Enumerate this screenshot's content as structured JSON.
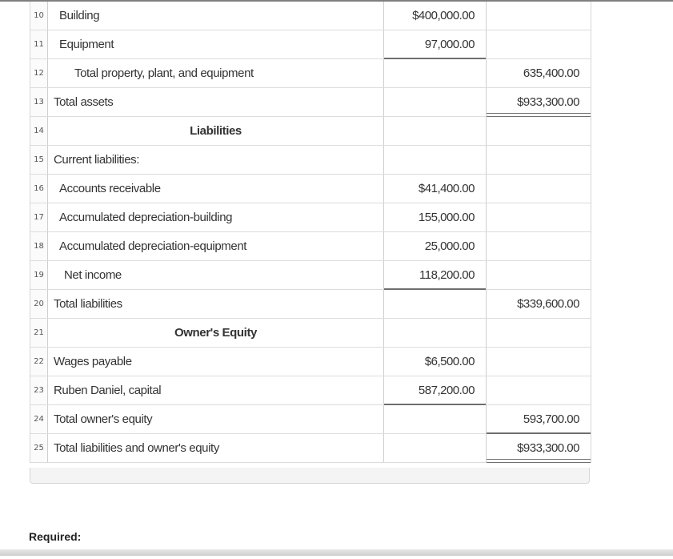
{
  "rows": [
    {
      "n": "10",
      "label": "Building",
      "c1": "$400,000.00",
      "c2": ""
    },
    {
      "n": "11",
      "label": "Equipment",
      "c1": "97,000.00",
      "c2": ""
    },
    {
      "n": "12",
      "label": "Total property, plant, and equipment",
      "c1": "",
      "c2": "635,400.00"
    },
    {
      "n": "13",
      "label": "Total assets",
      "c1": "",
      "c2": "$933,300.00"
    },
    {
      "n": "14",
      "label": "Liabilities",
      "c1": "",
      "c2": ""
    },
    {
      "n": "15",
      "label": "Current liabilities:",
      "c1": "",
      "c2": ""
    },
    {
      "n": "16",
      "label": "Accounts receivable",
      "c1": "$41,400.00",
      "c2": ""
    },
    {
      "n": "17",
      "label": "Accumulated depreciation-building",
      "c1": "155,000.00",
      "c2": ""
    },
    {
      "n": "18",
      "label": "Accumulated depreciation-equipment",
      "c1": "25,000.00",
      "c2": ""
    },
    {
      "n": "19",
      "label": "Net income",
      "c1": "118,200.00",
      "c2": ""
    },
    {
      "n": "20",
      "label": "Total liabilities",
      "c1": "",
      "c2": "$339,600.00"
    },
    {
      "n": "21",
      "label": "Owner's Equity",
      "c1": "",
      "c2": ""
    },
    {
      "n": "22",
      "label": "Wages payable",
      "c1": "$6,500.00",
      "c2": ""
    },
    {
      "n": "23",
      "label": "Ruben Daniel, capital",
      "c1": "587,200.00",
      "c2": ""
    },
    {
      "n": "24",
      "label": "Total owner's equity",
      "c1": "",
      "c2": "593,700.00"
    },
    {
      "n": "25",
      "label": "Total liabilities and owner's equity",
      "c1": "",
      "c2": "$933,300.00"
    }
  ],
  "required_label": "Required:"
}
